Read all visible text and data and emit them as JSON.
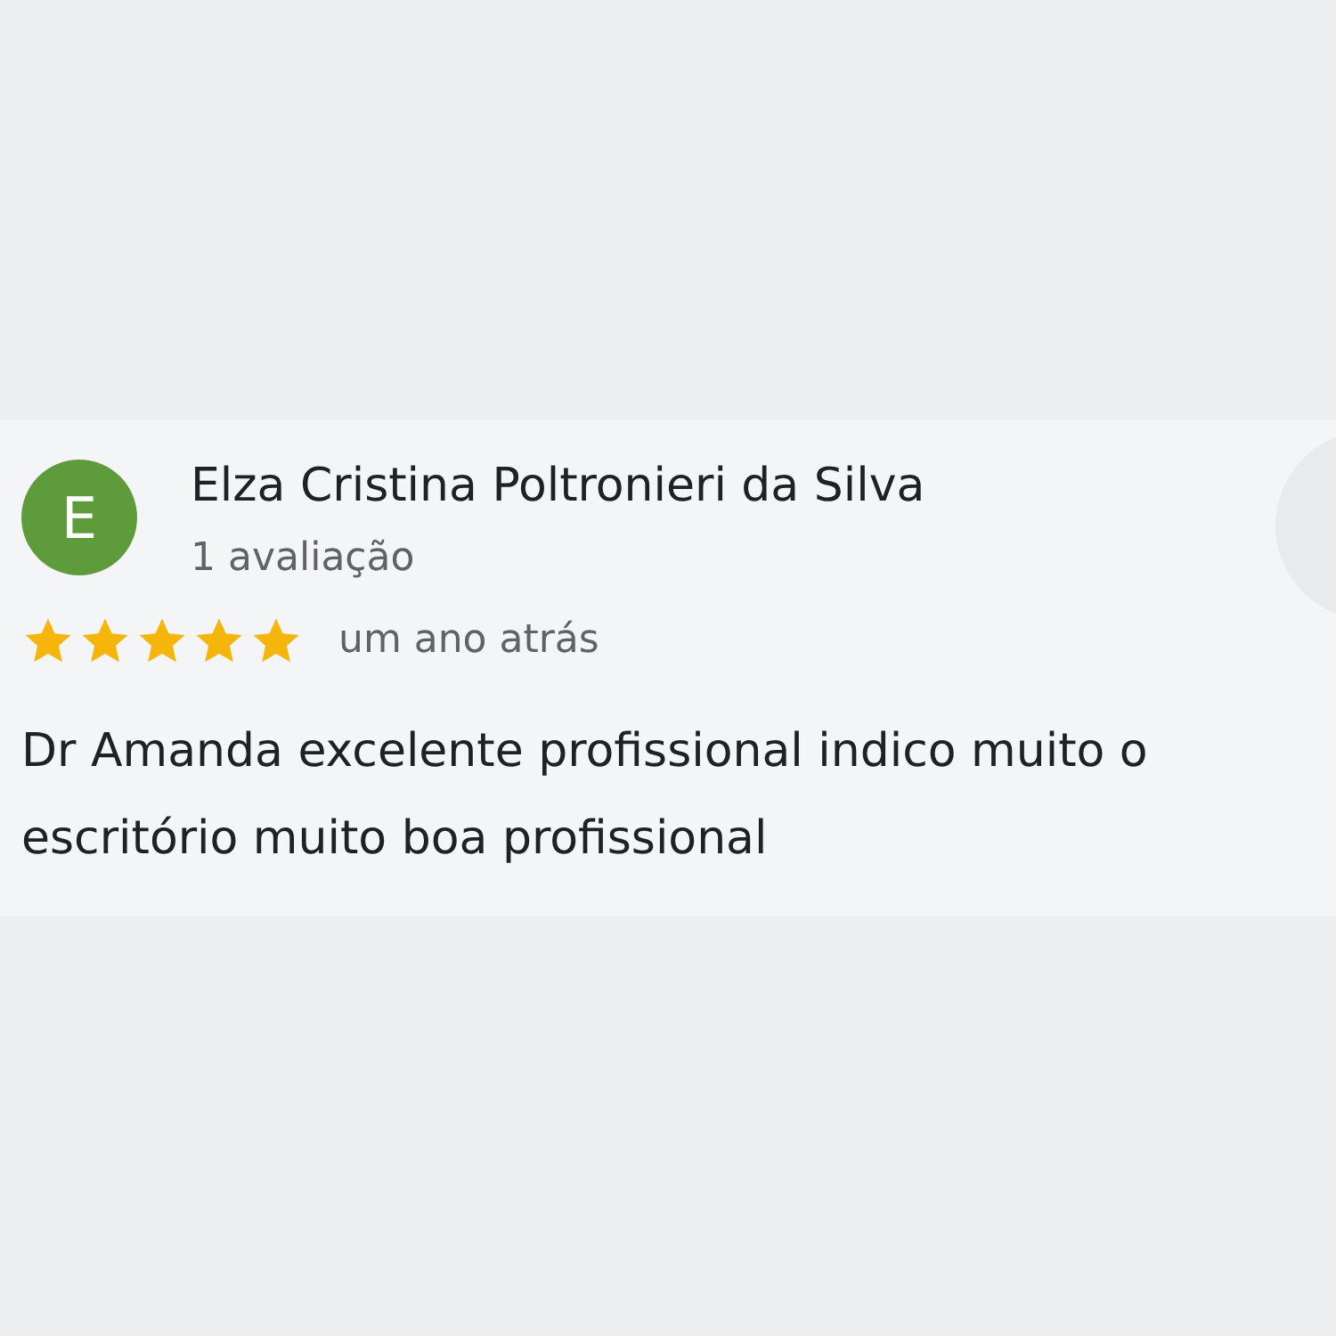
{
  "review": {
    "avatar_letter": "E",
    "author": "Elza Cristina Poltronieri da Silva",
    "review_count": "1 avaliação",
    "stars": 5,
    "time": "um ano atrás",
    "text": "Dr Amanda excelente profissional indico muito o escritório muito boa profissional"
  }
}
